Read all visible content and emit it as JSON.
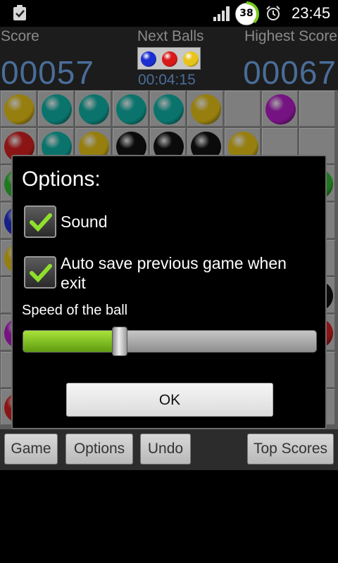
{
  "status_bar": {
    "battery_level": "38",
    "time": "23:45",
    "icons": [
      "clipboard-check-icon",
      "signal-icon",
      "battery-icon",
      "alarm-icon"
    ]
  },
  "header": {
    "score_label": "Score",
    "next_balls_label": "Next Balls",
    "highest_score_label": "Highest Score",
    "score": "00057",
    "highest_score": "00067",
    "timer": "00:04:15",
    "next_balls": [
      "#1a2fd1",
      "#d81a1a",
      "#e8c41a"
    ]
  },
  "colors": {
    "yellow": "#e6c217",
    "teal": "#10b2a6",
    "red": "#d62020",
    "black": "#111111",
    "purple": "#b21ec6",
    "blue": "#2230d0",
    "green": "#2fb82f",
    "accent": "#4a6d99",
    "slider_green": "#8ccc20"
  },
  "grid": {
    "rows": [
      [
        "yellow",
        "teal",
        "teal",
        "teal",
        "teal",
        "yellow",
        "",
        "purple",
        ""
      ],
      [
        "red",
        "teal",
        "yellow",
        "black",
        "black",
        "black",
        "yellow",
        "",
        ""
      ],
      [
        "green",
        "",
        "",
        "",
        "",
        "",
        "",
        "",
        "green"
      ],
      [
        "blue",
        "",
        "",
        "",
        "",
        "",
        "",
        "",
        ""
      ],
      [
        "yellow",
        "",
        "",
        "",
        "",
        "",
        "",
        "",
        ""
      ],
      [
        "",
        "",
        "",
        "",
        "",
        "",
        "",
        "",
        "black"
      ],
      [
        "purple",
        "",
        "",
        "",
        "",
        "",
        "",
        "",
        "red"
      ],
      [
        "",
        "",
        "",
        "",
        "",
        "",
        "",
        "",
        ""
      ],
      [
        "red",
        "",
        "",
        "",
        "",
        "",
        "",
        "",
        ""
      ]
    ]
  },
  "dialog": {
    "title": "Options:",
    "sound_label": "Sound",
    "sound_checked": true,
    "autosave_label": "Auto save previous game when exit",
    "autosave_checked": true,
    "speed_label": "Speed of the ball",
    "speed_value_fraction": 0.33,
    "ok_label": "OK"
  },
  "bottom_bar": {
    "game_label": "Game",
    "options_label": "Options",
    "undo_label": "Undo",
    "top_scores_label": "Top Scores"
  }
}
